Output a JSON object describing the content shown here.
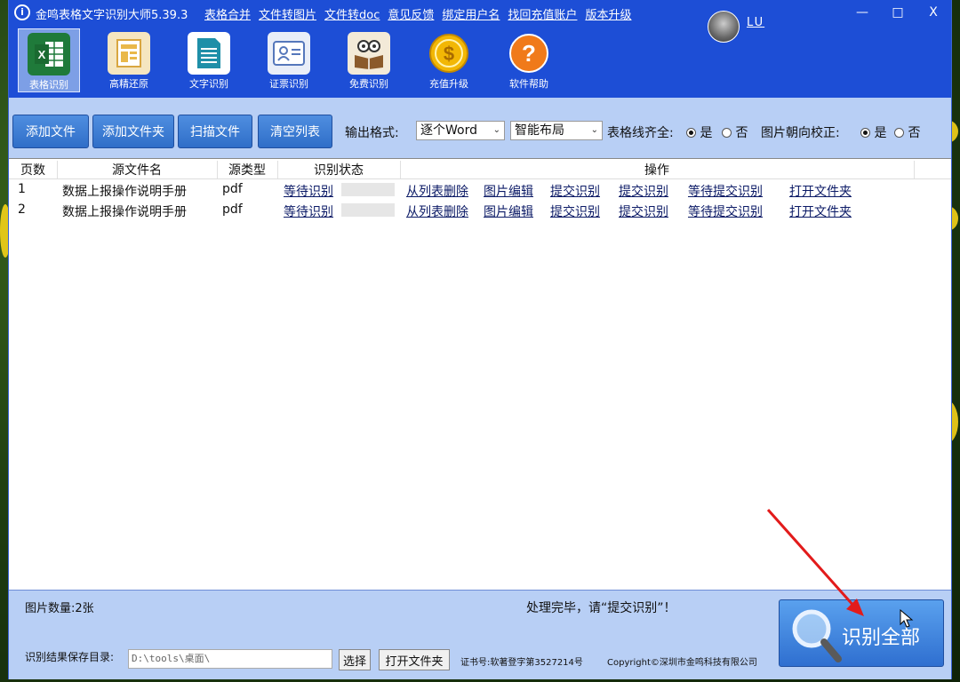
{
  "title": {
    "app_title": "金鸣表格文字识别大师5.39.3",
    "menu": [
      "表格合并",
      "文件转图片",
      "文件转doc",
      "意见反馈",
      "绑定用户名",
      "找回充值账户",
      "版本升级"
    ],
    "username": "LU",
    "minimize": "—",
    "maximize": "□",
    "close": "X"
  },
  "toolbar": [
    {
      "label": "表格识别",
      "icon": "excel-icon"
    },
    {
      "label": "高精还原",
      "icon": "layout-icon"
    },
    {
      "label": "文字识别",
      "icon": "document-icon"
    },
    {
      "label": "证票识别",
      "icon": "id-card-icon"
    },
    {
      "label": "免费识别",
      "icon": "owl-book-icon"
    },
    {
      "label": "充值升级",
      "icon": "dollar-coin-icon"
    },
    {
      "label": "软件帮助",
      "icon": "help-icon"
    }
  ],
  "actions": {
    "add_file": "添加文件",
    "add_folder": "添加文件夹",
    "scan_file": "扫描文件",
    "clear_list": "清空列表",
    "output_format_label": "输出格式:",
    "output_format_value": "逐个Word",
    "layout_value": "智能布局",
    "table_lines_label": "表格线齐全:",
    "yes": "是",
    "no": "否",
    "orientation_label": "图片朝向校正:"
  },
  "table": {
    "headers": [
      "页数",
      "源文件名",
      "源类型",
      "识别状态",
      "操作"
    ],
    "rows": [
      {
        "page": "1",
        "filename": "数据上报操作说明手册",
        "type": "pdf",
        "status": "等待识别"
      },
      {
        "page": "2",
        "filename": "数据上报操作说明手册",
        "type": "pdf",
        "status": "等待识别"
      }
    ],
    "ops": [
      "从列表删除",
      "图片编辑",
      "提交识别",
      "提交识别",
      "等待提交识别",
      "打开文件夹"
    ]
  },
  "bottom": {
    "image_count": "图片数量:2张",
    "message": "处理完毕，请“提交识别”！",
    "save_dir_label": "识别结果保存目录:",
    "save_dir_value": "D:\\tools\\桌面\\",
    "choose": "选择",
    "open_folder": "打开文件夹",
    "cert": "证书号:软著登字第3527214号",
    "copyright": "Copyright©深圳市金鸣科技有限公司",
    "recognize_all": "识别全部"
  }
}
